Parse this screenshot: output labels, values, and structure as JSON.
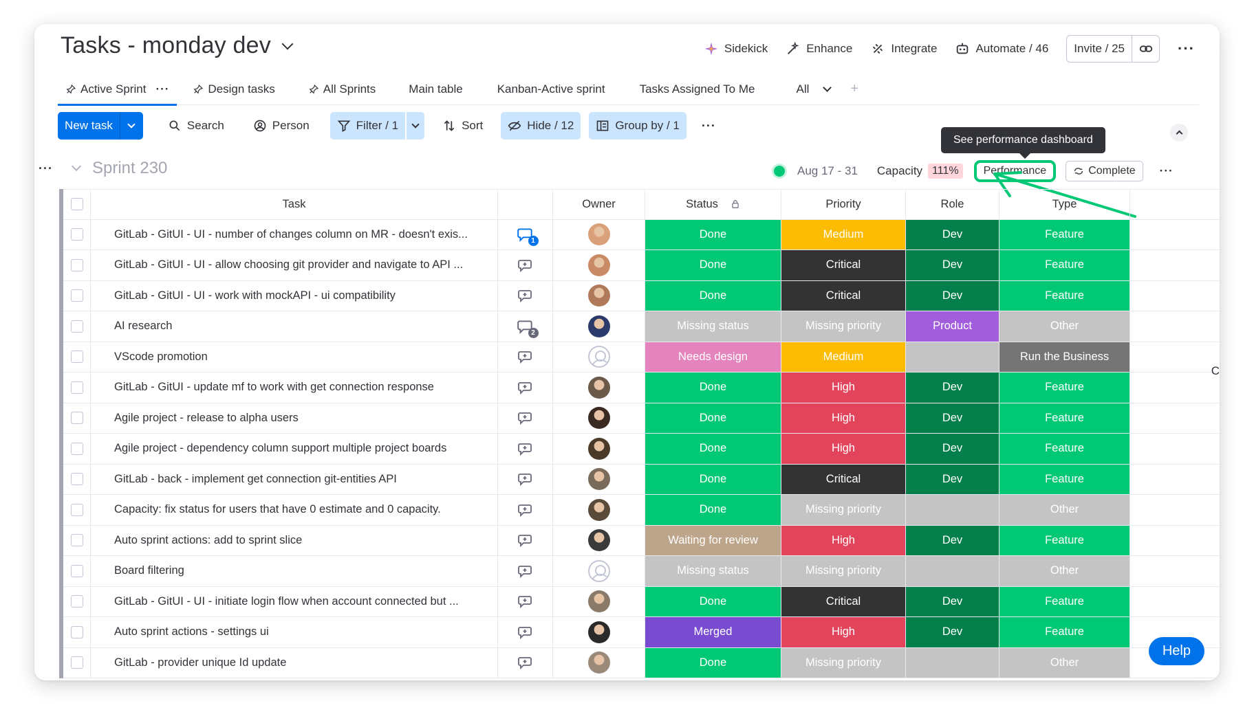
{
  "header": {
    "title": "Tasks - monday dev",
    "actions": {
      "sidekick": "Sidekick",
      "enhance": "Enhance",
      "integrate": "Integrate",
      "automate": "Automate / 46",
      "invite": "Invite / 25"
    }
  },
  "tabs": [
    {
      "label": "Active Sprint"
    },
    {
      "label": "Design tasks"
    },
    {
      "label": "All Sprints"
    },
    {
      "label": "Main table"
    },
    {
      "label": "Kanban-Active sprint"
    },
    {
      "label": "Tasks Assigned To Me"
    },
    {
      "label": "All"
    }
  ],
  "toolbar": {
    "new_task": "New task",
    "search": "Search",
    "person": "Person",
    "filter": "Filter / 1",
    "sort": "Sort",
    "hide": "Hide / 12",
    "group_by": "Group by / 1"
  },
  "group": {
    "name": "Sprint 230",
    "dates": "Aug 17 - 31",
    "capacity_label": "Capacity",
    "capacity_value": "111%",
    "performance": "Performance",
    "complete": "Complete",
    "tooltip": "See performance dashboard"
  },
  "columns": {
    "task": "Task",
    "owner": "Owner",
    "status": "Status",
    "priority": "Priority",
    "role": "Role",
    "type": "Type"
  },
  "colors": {
    "done": "#00c875",
    "medium": "#fdbc04",
    "critical": "#333333",
    "high": "#e2445c",
    "dev": "#037f4c",
    "feature": "#00c875",
    "missing": "#c4c4c4",
    "product": "#a25ddc",
    "needs_design": "#e484bd",
    "run_business": "#757575",
    "waiting": "#bca58a",
    "merged": "#784bd1",
    "accent": "#0073ea"
  },
  "rows": [
    {
      "task": "GitLab - GitUI - UI - number of changes column on MR - doesn't exis...",
      "upd": "1",
      "status": "Done",
      "priority": "Medium",
      "role": "Dev",
      "type": "Feature"
    },
    {
      "task": "GitLab - GitUI - UI - allow choosing git provider and navigate to API ...",
      "upd": "",
      "status": "Done",
      "priority": "Critical",
      "role": "Dev",
      "type": "Feature"
    },
    {
      "task": "GitLab - GitUI - UI - work with mockAPI - ui compatibility",
      "upd": "",
      "status": "Done",
      "priority": "Critical",
      "role": "Dev",
      "type": "Feature"
    },
    {
      "task": "AI research",
      "upd": "2",
      "status": "Missing status",
      "priority": "Missing priority",
      "role": "Product",
      "type": "Other"
    },
    {
      "task": "VScode promotion",
      "upd": "",
      "status": "Needs design",
      "priority": "Medium",
      "role": "",
      "type": "Run the Business"
    },
    {
      "task": "GitLab - GitUI - update mf to work with get connection response",
      "upd": "",
      "status": "Done",
      "priority": "High",
      "role": "Dev",
      "type": "Feature"
    },
    {
      "task": "Agile project - release to alpha users",
      "upd": "",
      "status": "Done",
      "priority": "High",
      "role": "Dev",
      "type": "Feature"
    },
    {
      "task": "Agile project - dependency column support multiple project boards",
      "upd": "",
      "status": "Done",
      "priority": "High",
      "role": "Dev",
      "type": "Feature"
    },
    {
      "task": "GitLab - back - implement get connection git-entities API",
      "upd": "",
      "status": "Done",
      "priority": "Critical",
      "role": "Dev",
      "type": "Feature"
    },
    {
      "task": "Capacity: fix status for users that have 0 estimate and 0 capacity.",
      "upd": "",
      "status": "Done",
      "priority": "Missing priority",
      "role": "",
      "type": "Other"
    },
    {
      "task": "Auto sprint actions: add to sprint slice",
      "upd": "",
      "status": "Waiting for review",
      "priority": "High",
      "role": "Dev",
      "type": "Feature"
    },
    {
      "task": "Board filtering",
      "upd": "",
      "status": "Missing status",
      "priority": "Missing priority",
      "role": "",
      "type": "Other"
    },
    {
      "task": "GitLab - GitUI - UI - initiate login flow when account connected but ...",
      "upd": "",
      "status": "Done",
      "priority": "Critical",
      "role": "Dev",
      "type": "Feature"
    },
    {
      "task": "Auto sprint actions - settings ui",
      "upd": "",
      "status": "Merged",
      "priority": "High",
      "role": "Dev",
      "type": "Feature"
    },
    {
      "task": "GitLab - provider unique Id update",
      "upd": "",
      "status": "Done",
      "priority": "Missing priority",
      "role": "",
      "type": "Other"
    }
  ],
  "help": "Help",
  "edge_char": "C"
}
